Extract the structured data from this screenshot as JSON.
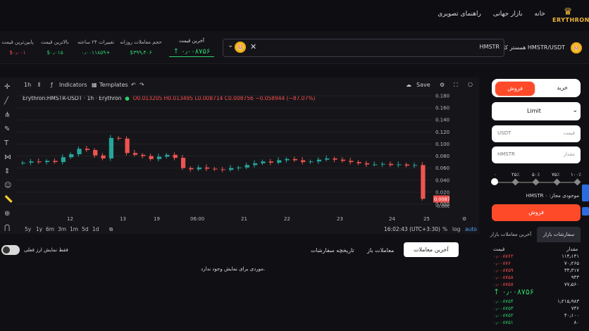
{
  "nav": {
    "logo_text": "ERYTHRON",
    "links": [
      "خانه",
      "بازار جهانی",
      "راهنمای تصویری"
    ]
  },
  "ticker": {
    "pair_name": "همستر کامبت HMSTR/USDT",
    "search_symbol": "HMSTR",
    "last_price_label": "آخرین قیمت",
    "last_price_value": "↑ ۰٫۰۰۸۷۵۶",
    "stats": [
      {
        "label": "حجم معاملات روزانه",
        "value": "$۳۹۹٫۴۰۶",
        "color": "green"
      },
      {
        "label": "تغییرات ۲۴ ساعته",
        "value": "۰٫۰۰۱۱۸۵۹+",
        "color": "green"
      },
      {
        "label": "بالاترین قیمت",
        "value": "$۰٫۰۱۵",
        "color": "green"
      },
      {
        "label": "پایین‌ترین قیمت",
        "value": "$۰٫۰۰۱",
        "color": "red"
      }
    ]
  },
  "chart_toolbar": {
    "interval": "1h",
    "indicators": "Indicators",
    "templates": "Templates",
    "save": "Save"
  },
  "chart_legend": {
    "symbol": "Erythron:HMSTR-USDT · 1h · Erythron",
    "ohlc": "O0.013205 H0.013495 L0.008714 C0.008756 −0.058944 (−87.07%)"
  },
  "chart_data": {
    "type": "candlestick",
    "x_ticks": [
      "12",
      "13",
      "19",
      "06:00",
      "21",
      "22",
      "23",
      "24",
      "25"
    ],
    "y_ticks": [
      "0.180000",
      "0.160000",
      "0.140000",
      "0.120000",
      "0.100000",
      "0.080000",
      "0.060000",
      "0.040000",
      "0.020000",
      "0.000000"
    ],
    "last_price_tag": "0.008756",
    "min_tag": "-0.000000",
    "ylim": [
      0,
      0.18
    ],
    "approx_close_series": [
      0.069,
      0.071,
      0.07,
      0.072,
      0.07,
      0.078,
      0.083,
      0.092,
      0.09,
      0.081,
      0.076,
      0.11,
      0.109,
      0.085,
      0.082,
      0.08,
      0.075,
      0.079,
      0.082,
      0.077,
      0.06,
      0.058,
      0.061,
      0.059,
      0.058,
      0.057,
      0.06,
      0.061,
      0.065,
      0.068,
      0.071,
      0.069,
      0.073,
      0.075,
      0.073,
      0.07,
      0.071,
      0.074,
      0.076,
      0.074,
      0.072,
      0.07,
      0.068,
      0.066,
      0.066,
      0.067,
      0.065,
      0.066,
      0.064,
      0.065,
      0.009
    ]
  },
  "chart_bottom": {
    "ranges": [
      "5y",
      "1y",
      "6m",
      "3m",
      "1m",
      "5d",
      "1d"
    ],
    "time": "16:02:43 (UTC+3:30)",
    "pct": "%",
    "log": "log",
    "auto": "auto"
  },
  "order_panel": {
    "buy_tab": "خرید",
    "sell_tab": "فروش",
    "order_type": "Limit",
    "price_placeholder": "قیمت",
    "price_unit": "USDT",
    "amount_placeholder": "مقدار",
    "amount_unit": "HMSTR",
    "percents": [
      "۱۰۰٪",
      "۷۵٪",
      "۵۰٪",
      "۲۵٪",
      "۰"
    ],
    "available_label": "موجودی مجاز: HMSTR ۰",
    "submit": "فروش"
  },
  "order_book": {
    "tabs": [
      "سفارشات بازار",
      "آخرین معاملات بازار"
    ],
    "col_amount": "مقدار",
    "col_price": "قیمت",
    "asks": [
      {
        "amount": "۱۱۴٫۱۴۱",
        "price": "۰٫۰۰۸۷۶۲"
      },
      {
        "amount": "۷۰٫۲۶۵",
        "price": "۰٫۰۰۸۷۶"
      },
      {
        "amount": "۳۳٫۳۱۷",
        "price": "۰٫۰۰۸۷۵۹"
      },
      {
        "amount": "۹۴۳",
        "price": "۰٫۰۰۸۷۵۸"
      },
      {
        "amount": "۷۷٫۵۶۰",
        "price": "۰٫۰۰۸۷۵۷"
      }
    ],
    "mid_price": "↑ ۰٫۰۰۸۷۵۶",
    "bids": [
      {
        "amount": "۱٫۲۱۵٫۹۸۳",
        "price": "۰٫۰۰۸۷۵۴"
      },
      {
        "amount": "۷۳۶",
        "price": "۰٫۰۰۸۷۵۳"
      },
      {
        "amount": "۴۰٫۱۰۰",
        "price": "۰٫۰۰۸۷۵۲"
      },
      {
        "amount": "۸۰",
        "price": "۰٫۰۰۸۷۵۱"
      }
    ]
  },
  "bottom": {
    "tabs": [
      "آخرین معاملات",
      "معاملات باز",
      "تاریخچه سفارشات"
    ],
    "toggle_label": "فقط نمایش ارز فعلی",
    "empty_message": "موردی برای نمایش وجود ندارد."
  }
}
